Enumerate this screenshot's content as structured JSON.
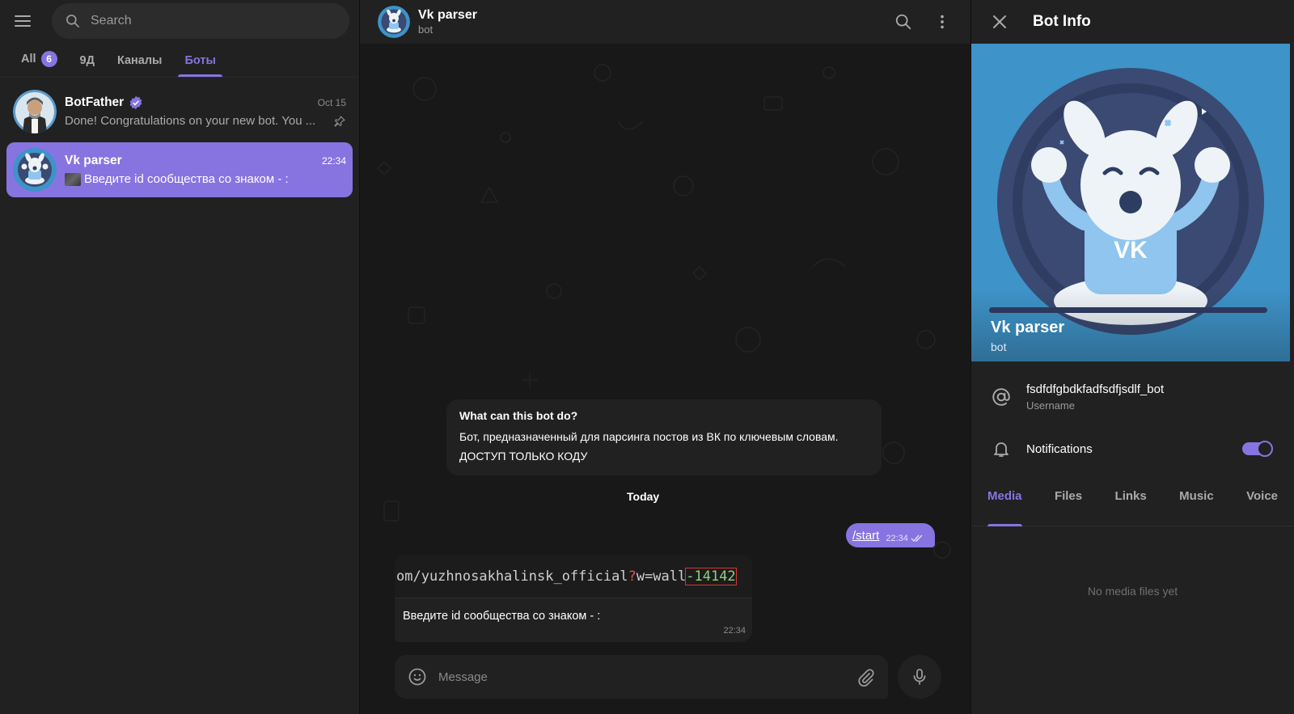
{
  "sidebar": {
    "search_placeholder": "Search",
    "folders": [
      {
        "label": "All",
        "badge": "6"
      },
      {
        "label": "9Д"
      },
      {
        "label": "Каналы"
      },
      {
        "label": "Боты"
      }
    ],
    "active_folder": "Боты",
    "chats": [
      {
        "name": "BotFather",
        "verified": true,
        "time": "Oct 15",
        "preview": "Done! Congratulations on your new bot. You ...",
        "pinned": true
      },
      {
        "name": "Vk parser",
        "time": "22:34",
        "preview": "Введите id сообщества со знаком - :",
        "active": true
      }
    ]
  },
  "chat": {
    "title": "Vk parser",
    "subtitle": "bot",
    "intro_title": "What can this bot do?",
    "intro_line1": "Бот, предназначенный для парсинга постов из ВК по ключевым словам.",
    "intro_line2": "ДОСТУП ТОЛЬКО КОДУ",
    "date_label": "Today",
    "outgoing": {
      "text": "/start",
      "time": "22:34"
    },
    "incoming": {
      "image_text_pre": "om/yuzhnosakhalinsk_official",
      "image_text_q": "?",
      "image_text_mid": "w=wall",
      "image_text_num": "-14142",
      "text": "Введите id сообщества со знаком - :",
      "time": "22:34"
    },
    "composer_placeholder": "Message"
  },
  "info": {
    "title": "Bot Info",
    "name": "Vk parser",
    "subtitle": "bot",
    "username": "fsdfdfgbdkfadfsdfjsdlf_bot",
    "username_label": "Username",
    "notifications_label": "Notifications",
    "notifications_on": true,
    "tabs": [
      "Media",
      "Files",
      "Links",
      "Music",
      "Voice"
    ],
    "active_tab": "Media",
    "empty_text": "No media files yet"
  },
  "colors": {
    "accent": "#8774e1",
    "panel": "#212121",
    "background": "#181818",
    "avatar_blue": "#3e93c8"
  }
}
